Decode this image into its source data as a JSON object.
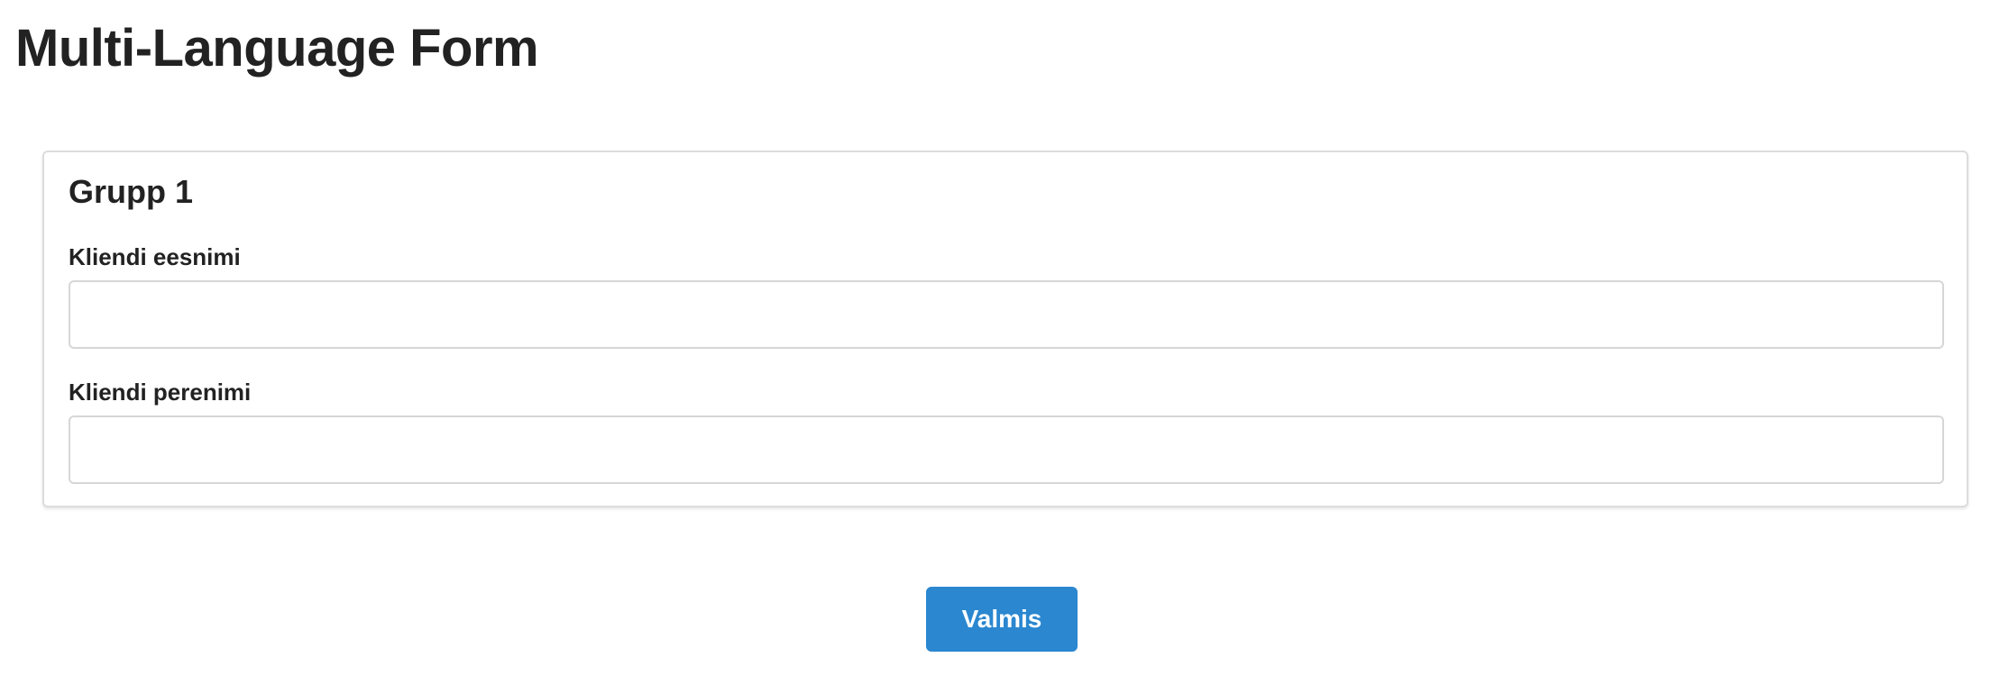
{
  "page": {
    "title": "Multi-Language Form"
  },
  "group": {
    "title": "Grupp 1",
    "fields": [
      {
        "label": "Kliendi eesnimi",
        "value": "",
        "placeholder": ""
      },
      {
        "label": "Kliendi perenimi",
        "value": "",
        "placeholder": ""
      }
    ]
  },
  "actions": {
    "submit_label": "Valmis"
  },
  "colors": {
    "accent": "#2a87d0",
    "text": "#222222",
    "border": "#d6d6d6"
  }
}
